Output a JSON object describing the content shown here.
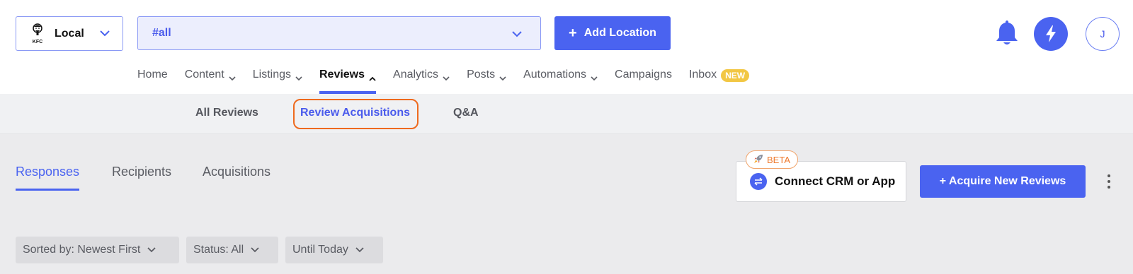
{
  "brand": {
    "name": "Local",
    "logo_text": "KFC",
    "logo_icon": "kfc-logo"
  },
  "tag_select": {
    "value": "#all"
  },
  "header": {
    "add_location_label": "Add Location",
    "icons": [
      "bell-icon",
      "bolt-icon"
    ],
    "avatar_initial": "J"
  },
  "nav": {
    "items": [
      {
        "label": "Home",
        "has_chevron": false
      },
      {
        "label": "Content",
        "has_chevron": true
      },
      {
        "label": "Listings",
        "has_chevron": true
      },
      {
        "label": "Reviews",
        "has_chevron": true,
        "active": true
      },
      {
        "label": "Analytics",
        "has_chevron": true
      },
      {
        "label": "Posts",
        "has_chevron": true
      },
      {
        "label": "Automations",
        "has_chevron": true
      },
      {
        "label": "Campaigns",
        "has_chevron": false
      },
      {
        "label": "Inbox",
        "badge": "NEW"
      }
    ]
  },
  "subnav": {
    "items": [
      {
        "label": "All Reviews"
      },
      {
        "label": "Review Acquisitions",
        "active": true
      },
      {
        "label": "Q&A"
      }
    ]
  },
  "tabs": [
    {
      "label": "Responses",
      "active": true
    },
    {
      "label": "Recipients"
    },
    {
      "label": "Acquisitions"
    }
  ],
  "connect": {
    "label": "Connect CRM or App",
    "badge": "BETA",
    "badge_icon": "rocket-icon"
  },
  "acquire_label": "+ Acquire New Reviews",
  "filters": [
    {
      "label": "Sorted by: Newest First"
    },
    {
      "label": "Status: All"
    },
    {
      "label": "Until Today"
    }
  ],
  "colors": {
    "accent": "#4a63f0",
    "highlight": "#ee6a1e",
    "badge_new": "#f2c744",
    "beta": "#ee7a2e"
  }
}
